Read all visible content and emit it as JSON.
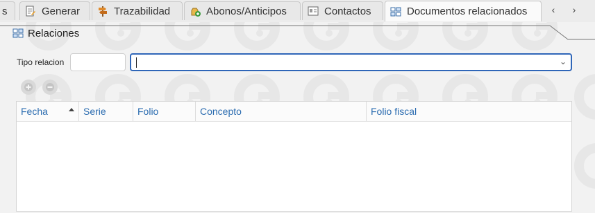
{
  "tabs": [
    {
      "label": "s",
      "icon": "document-icon"
    },
    {
      "label": "Generar",
      "icon": "edit-document-icon"
    },
    {
      "label": "Trazabilidad",
      "icon": "signpost-icon"
    },
    {
      "label": "Abonos/Anticipos",
      "icon": "money-bag-add-icon"
    },
    {
      "label": "Contactos",
      "icon": "contact-card-icon"
    },
    {
      "label": "Documentos relacionados",
      "icon": "related-docs-icon"
    }
  ],
  "active_tab": "Documentos relacionados",
  "nav": {
    "prev": "‹",
    "next": "›"
  },
  "section": {
    "title": "Relaciones",
    "icon": "related-docs-icon"
  },
  "filters": {
    "tipo_relacion_label": "Tipo relacion",
    "tipo_relacion_code": "",
    "tipo_relacion_value": "",
    "dropdown_indicator": "⌄"
  },
  "buttons": {
    "add": {
      "icon": "add-icon",
      "enabled": false
    },
    "remove": {
      "icon": "remove-icon",
      "enabled": false
    }
  },
  "grid": {
    "columns": [
      "Fecha",
      "Serie",
      "Folio",
      "Concepto",
      "Folio fiscal"
    ],
    "sorted_column": "Fecha",
    "sort_direction": "ascending",
    "rows": []
  },
  "colors": {
    "header_text": "#2b6cb0",
    "focus_border": "#2f66b8",
    "watermark": "#e4e4e4"
  }
}
